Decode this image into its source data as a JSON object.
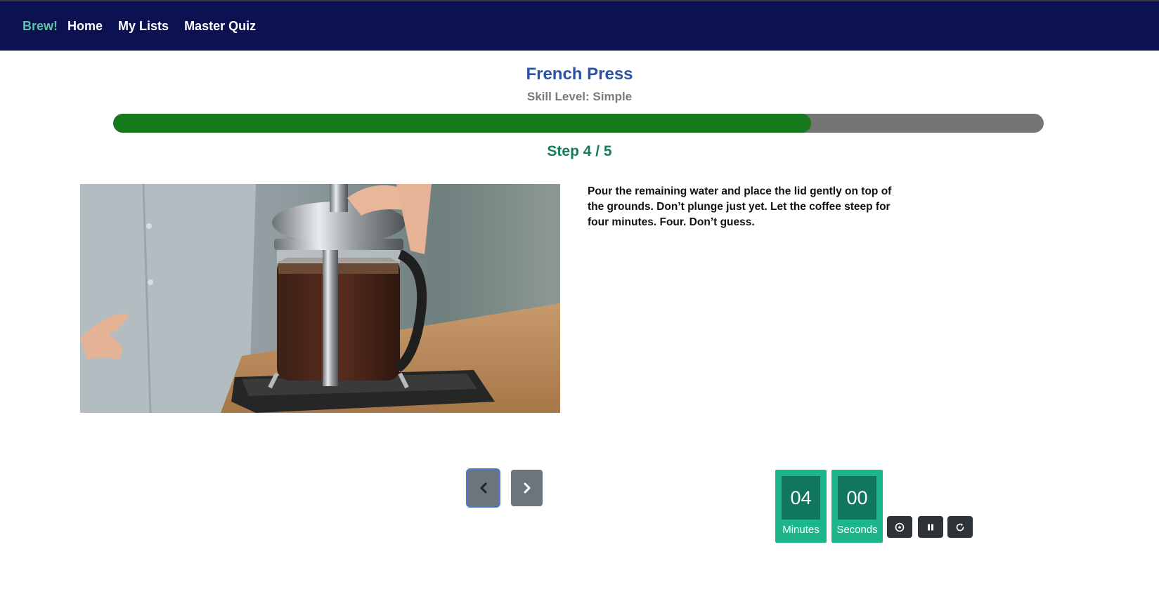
{
  "nav": {
    "brand": "Brew!",
    "links": [
      "Home",
      "My Lists",
      "Master Quiz"
    ]
  },
  "recipe": {
    "title": "French Press",
    "skill_level": "Skill Level: Simple",
    "progress_fraction": 0.75,
    "step_text": "Step 4 / 5",
    "instruction": "Pour the remaining water and place the lid gently on top of the grounds. Don’t plunge just yet. Let the coffee steep for four minutes. Four. Don’t guess."
  },
  "timer": {
    "minutes": "04",
    "seconds": "00",
    "minutes_label": "Minutes",
    "seconds_label": "Seconds"
  },
  "icons": {
    "prev": "chevron-left-icon",
    "next": "chevron-right-icon",
    "start": "play-circle-icon",
    "pause": "pause-icon",
    "reset": "reset-icon"
  },
  "colors": {
    "navbar": "#0b1151",
    "brand": "#5ec4a1",
    "title": "#2b52a3",
    "progress_fill": "#16791c",
    "progress_track": "#757575",
    "step": "#187a5d",
    "timer_box": "#1db58a",
    "timer_digit": "#11765f"
  }
}
